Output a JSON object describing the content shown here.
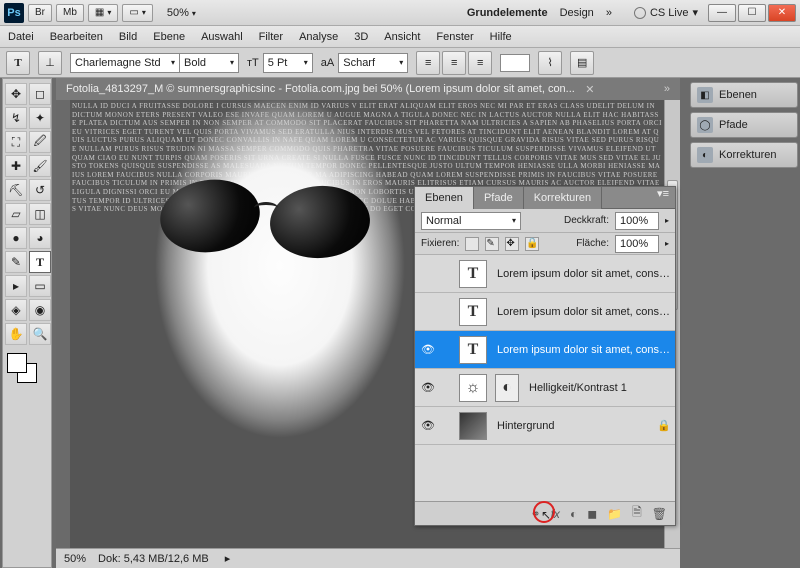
{
  "chart_data": null,
  "winbar": {
    "br": "Br",
    "mb": "Mb",
    "zoom": "50%",
    "ws1": "Grundelemente",
    "ws2": "Design",
    "more": "»",
    "cs": "CS Live"
  },
  "menubar": [
    "Datei",
    "Bearbeiten",
    "Bild",
    "Ebene",
    "Auswahl",
    "Filter",
    "Analyse",
    "3D",
    "Ansicht",
    "Fenster",
    "Hilfe"
  ],
  "options": {
    "tool": "T",
    "font_name": "Charlemagne Std",
    "font_weight": "Bold",
    "size": "5 Pt",
    "aa_label": "aA",
    "aa": "Scharf"
  },
  "doctab": "Fotolia_4813297_M © sumnersgraphicsinc - Fotolia.com.jpg bei 50% (Lorem ipsum dolor sit amet, con...",
  "status": {
    "zoom": "50%",
    "dok": "Dok: 5,43 MB/12,6 MB"
  },
  "dock": [
    {
      "icon": "◧",
      "label": "Ebenen"
    },
    {
      "icon": "◯",
      "label": "Pfade"
    },
    {
      "icon": "◐",
      "label": "Korrekturen"
    }
  ],
  "layerspanel": {
    "tabs": [
      "Ebenen",
      "Pfade",
      "Korrekturen"
    ],
    "blend": "Normal",
    "deck_label": "Deckkraft:",
    "deck": "100%",
    "fix_label": "Fixieren:",
    "fill_label": "Fläche:",
    "fill": "100%",
    "layers": [
      {
        "eye": "",
        "thumb": "T",
        "name": "Lorem ipsum dolor sit amet, consectet...",
        "sel": false
      },
      {
        "eye": "",
        "thumb": "T",
        "name": "Lorem ipsum dolor sit amet, consectet...",
        "sel": false
      },
      {
        "eye": "👁",
        "thumb": "T",
        "name": "Lorem ipsum dolor sit amet, conse...",
        "sel": true
      },
      {
        "eye": "👁",
        "thumb": "☼",
        "name": "Helligkeit/Kontrast 1",
        "sel": false,
        "adj": true
      },
      {
        "eye": "👁",
        "thumb": "img",
        "name": "Hintergrund",
        "sel": false,
        "lock": "🔒"
      }
    ],
    "bottom": [
      "⚭",
      "fx",
      "◐",
      "◼",
      "📁",
      "🗎",
      "🗑"
    ]
  },
  "lorem": "NULLA ID DUCI A FRUITASSE DOLORE I CURSUS MAECEN ENIM ID VARIUS V ELIT ERAT ALIQUAM ELIT EROS NEC MI PAR ET ERAS CLASS UDELIT DELUM IN DICTUM MONON ETERS PRESENT VALEO ESE INVAFE QUAM LOREM U AUGUE MAGNA A TIGULA DONEC NEC IN LACTUS AUCTOR NULLA ELIT HAC HABITASSE PLATEA DICTUM AUS SEMPER IN NON SEMPER AT COMMODO SIT PLACERAT FAUCIBUS SIT PHARETTA NAM ULTRICIES A SAPIEN AB PHASELIUS PORTA ORCI EU VITRICES EGET TURENT VEL QUIS PORTA VIVAMUS SED ERATULLA NIUS INTERDIS MUS VEL FETORES AT TINCIDUNT ELIT AENEAN BLANDIT LOREM AT QUIS LUCTUS PURUS ALIQUAM UT DONEC CONVALLIS IN NAFE QUAM LOREM U CONSECTETUR AC VARIUS QUISQUE GRAVIDA RISUS VITAE SED PURUS RISQUE NULLAM PURUS RISUS TRUDIN NI MASSA SEMPER COMMODO QUIS PHARETRA VITAE POSUERE FAUCIBUS TICULUM SUSPERDISSE VIVAMUS ELEIFEND UT QUAM CIAO EU NUNT TURPIS QUAM POSERIS SIT URNA CREATE SI NULLA FUSCE FUSCE NUNC ID TINCIDUNT TELLUS CORPORIS VITAE MUS SED VITAE EL JUSTO TOKENS QUISQUE SUSPENDISSE AS MALESUADA NICTUM TEMPOR DONEC PELLENTESQUE JUSTO ULTUM TEMPOR HENIASSE ULLA MORBI HENIASSE MAIUS LOREM FAUCIBUS NULLA CORPORIS MAURIS VITAE SEMPER MA ADIPISCING HABEAD QUAM LOREM SUSPENDISSE PRIMIS IN FAUCIBUS VITAE POSUERE FAUCIBUS TICULUM IN PRIMIS IN FAUCIBUS TELLUS NAM QUIS FAUCIBUS IN EROS MAURIS ELITRISUS ETIAM CURSUS MAURIS AC AUCTOR ELEIFEND VITAE LIGULA DIGNISSI ORCI EU MASSA CRAS SIT NULLA IN ULUM CONSEQUAT NON LOBORTIS UT LAOREET FERDIGET NULLA CORPORIS SEMPER MASLE ENIM METUS TEMPOR ID ULTRICES ALIQUAM MUS HENDRERIT DICTUM TEMPOR DONEC DOLUE HABITANT MORBI TRISTIQUE SENECTUS ETEGESTAS ESTETAS TELLUS VITAE NUNC DEUS MOLESTIE TELLUS VESTIBULUM VITAE QUIS RISQUE ELIT DO EGET CONVALLIS LECTUS"
}
